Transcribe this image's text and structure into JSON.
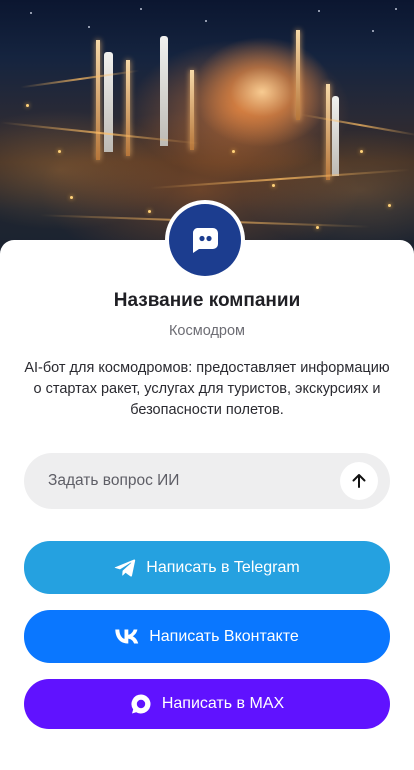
{
  "profile": {
    "name": "Название компании",
    "category": "Космодром",
    "description": "AI-бот для космодромов: предоставляет информацию о стартах ракет, услугах для туристов, экскурсиях и безопасности полетов.",
    "avatar_icon": "chat-bot-icon",
    "avatar_color": "#1c3d8f"
  },
  "hero": {
    "image": "night-spaceport-rocket-launch"
  },
  "ask": {
    "placeholder": "Задать вопрос ИИ",
    "value": "",
    "send_icon": "arrow-up-icon"
  },
  "actions": {
    "telegram": {
      "label": "Написать в Telegram",
      "icon": "telegram-icon",
      "color": "#25a1e0"
    },
    "vk": {
      "label": "Написать Вконтакте",
      "icon": "vk-icon",
      "color": "#0a77ff"
    },
    "max": {
      "label": "Написать в MAX",
      "icon": "max-messenger-icon",
      "color": "#6012ff"
    }
  }
}
